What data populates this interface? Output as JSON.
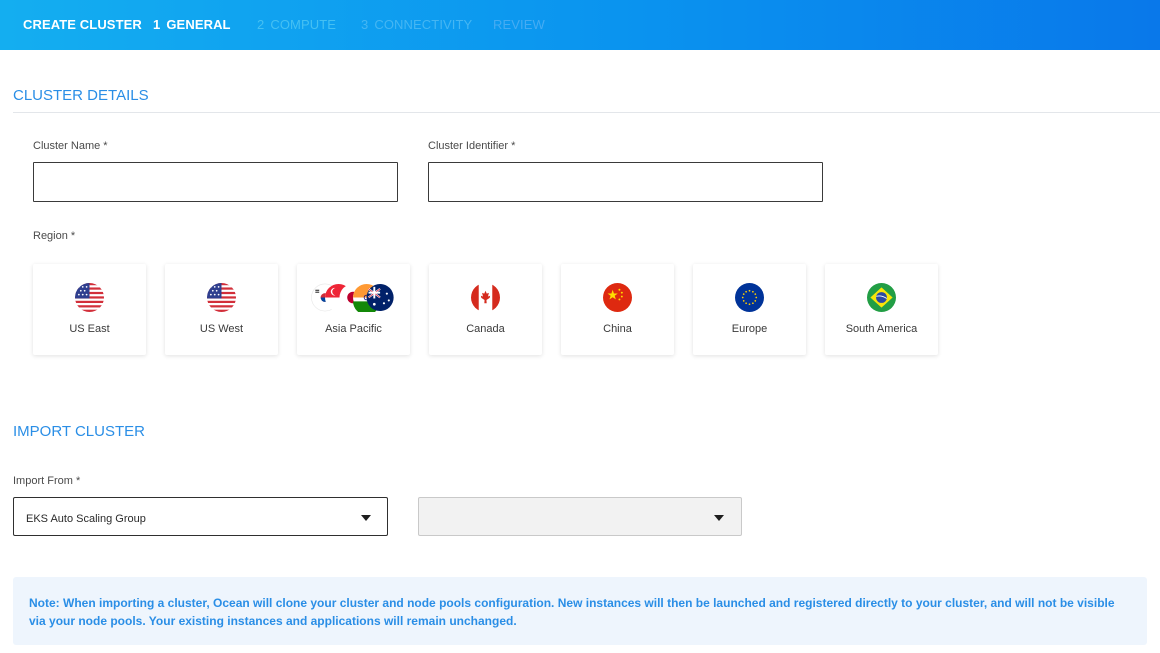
{
  "header": {
    "title": "CREATE CLUSTER",
    "steps": [
      {
        "number": "1",
        "label": "GENERAL",
        "state": "active"
      },
      {
        "number": "2",
        "label": "COMPUTE",
        "state": "inactive"
      },
      {
        "number": "3",
        "label": "CONNECTIVITY",
        "state": "inactive"
      },
      {
        "number": "",
        "label": "REVIEW",
        "state": "inactive"
      }
    ]
  },
  "cluster_details": {
    "title": "CLUSTER DETAILS",
    "cluster_name": {
      "label": "Cluster Name *",
      "value": "",
      "placeholder": ""
    },
    "cluster_identifier": {
      "label": "Cluster Identifier *",
      "value": "",
      "placeholder": ""
    },
    "region_label": "Region *",
    "regions": [
      {
        "name": "US East",
        "icon": "us-flag-icon"
      },
      {
        "name": "US West",
        "icon": "us-flag-icon"
      },
      {
        "name": "Asia Pacific",
        "icon": "asia-pacific-flags-icon"
      },
      {
        "name": "Canada",
        "icon": "canada-flag-icon"
      },
      {
        "name": "China",
        "icon": "china-flag-icon"
      },
      {
        "name": "Europe",
        "icon": "eu-flag-icon"
      },
      {
        "name": "South America",
        "icon": "brazil-flag-icon"
      }
    ]
  },
  "import_cluster": {
    "title": "IMPORT CLUSTER",
    "import_from_label": "Import From *",
    "import_from_value": "EKS Auto Scaling Group",
    "secondary_value": ""
  },
  "note": {
    "text": "Note: When importing a cluster, Ocean will clone your cluster and node pools configuration. New instances will then be launched and registered directly to your cluster, and will not be visible via your node pools. Your existing instances and applications will remain unchanged."
  },
  "colors": {
    "accent": "#2a8ee6",
    "header_start": "#14aef0",
    "header_end": "#0978ea",
    "note_background": "#eef5fd"
  }
}
